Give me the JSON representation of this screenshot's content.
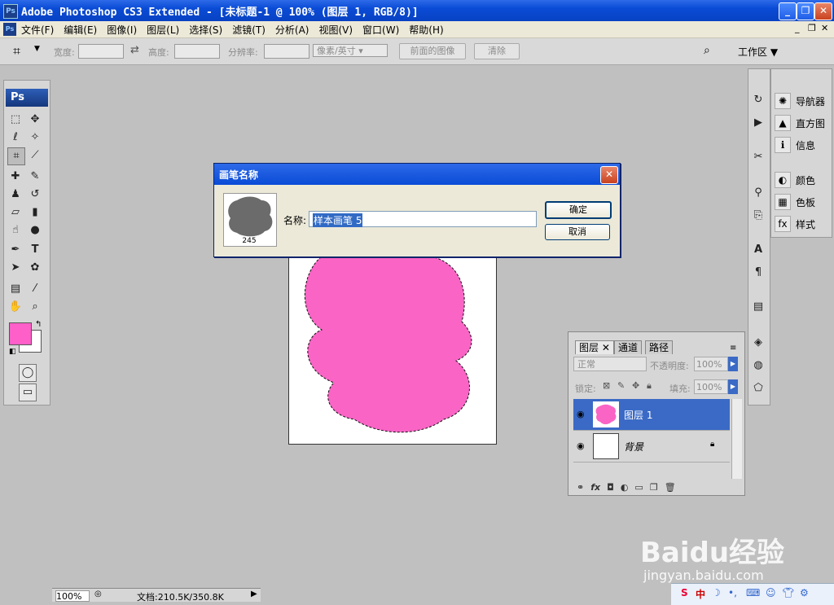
{
  "window": {
    "title": "Adobe Photoshop CS3 Extended - [未标题-1 @ 100% (图层 1, RGB/8)]",
    "app_icon": "Ps"
  },
  "menu": {
    "items": [
      "文件(F)",
      "编辑(E)",
      "图像(I)",
      "图层(L)",
      "选择(S)",
      "滤镜(T)",
      "分析(A)",
      "视图(V)",
      "窗口(W)",
      "帮助(H)"
    ]
  },
  "options": {
    "width_label": "宽度:",
    "height_label": "高度:",
    "resolution_label": "分辨率:",
    "unit_select": "像素/英寸",
    "front_image_btn": "前面的图像",
    "clear_btn": "清除",
    "workspace_label": "工作区 ▼"
  },
  "toolbox": {
    "logo": "Ps"
  },
  "dialog": {
    "title": "画笔名称",
    "brush_size": "245",
    "name_label": "名称:",
    "name_value": "样本画笔 5",
    "ok_label": "确定",
    "cancel_label": "取消"
  },
  "panels": {
    "dock": [
      "导航器",
      "直方图",
      "信息",
      "颜色",
      "色板",
      "样式"
    ]
  },
  "layers": {
    "tabs": [
      "图层",
      "通道",
      "路径"
    ],
    "blend_mode": "正常",
    "opacity_label": "不透明度:",
    "opacity_value": "100%",
    "lock_label": "锁定:",
    "fill_label": "填充:",
    "fill_value": "100%",
    "rows": [
      {
        "name": "图层 1",
        "selected": true
      },
      {
        "name": "背景",
        "selected": false
      }
    ]
  },
  "status": {
    "zoom": "100%",
    "doc_info": "文档:210.5K/350.8K"
  },
  "colors": {
    "foreground": "#ff5fc8",
    "shape_fill": "#f964c5",
    "selection": "#3a6ac6"
  },
  "watermark": {
    "logo_text": "Baidu经验",
    "url": "jingyan.baidu.com"
  }
}
